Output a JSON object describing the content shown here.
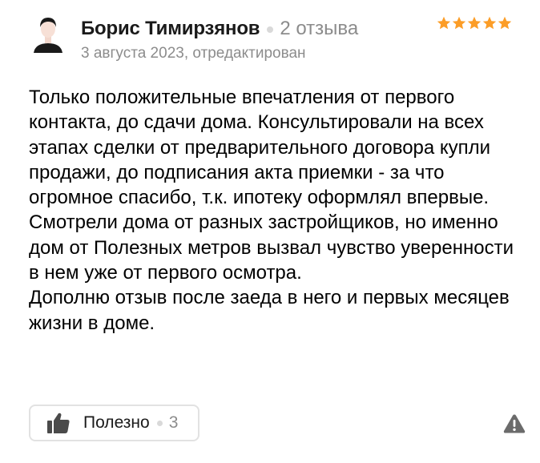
{
  "author": {
    "name": "Борис Тимирзянов",
    "review_count": "2 отзыва"
  },
  "meta": "3 августа 2023, отредактирован",
  "rating": {
    "value": 5,
    "max": 5,
    "star_color": "#fc9d27"
  },
  "review_paragraphs": [
    "Только положительные впечатления от первого контакта, до сдачи дома. Консультировали на всех этапах сделки от предварительного договора купли продажи, до подписания акта приемки - за что огромное спасибо, т.к. ипотеку оформлял впервые.",
    "Смотрели дома от разных застройщиков, но именно дом от Полезных метров вызвал чувство уверенности в нем уже от первого осмотра.",
    "Дополню отзыв после заеда в него и первых месяцев жизни в доме."
  ],
  "helpful": {
    "label": "Полезно",
    "count": "3"
  },
  "icons": {
    "avatar": "user-avatar-icon",
    "star": "star-icon",
    "thumb": "thumbs-up-icon",
    "warning": "warning-icon"
  }
}
